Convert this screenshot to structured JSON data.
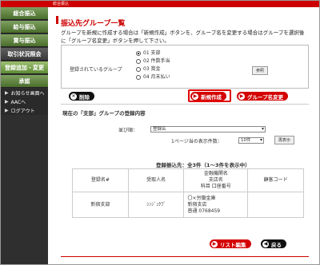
{
  "sidebar": {
    "items": [
      {
        "label": "総合振込",
        "style": "green"
      },
      {
        "label": "給与振込",
        "style": "green"
      },
      {
        "label": "賞与振込",
        "style": "green"
      },
      {
        "label": "取引状況照会",
        "style": "dark"
      },
      {
        "label": "登録追加・変更",
        "style": "active"
      },
      {
        "label": "承認",
        "style": "green"
      }
    ],
    "subs": [
      {
        "label": "お知らせ画面へ"
      },
      {
        "label": "AACへ"
      },
      {
        "label": "ログアウト"
      }
    ]
  },
  "topbar": {
    "label": "総合振込"
  },
  "main": {
    "title": "振込先グループ一覧",
    "intro": "グループを新規に作成する場合は「新規作成」ボタンを、グループ名を変更する場合はグループを選択後に「グループ名変更」ボタンを押して下さい。",
    "group_label": "登録されているグループ",
    "groups": [
      {
        "label": "01 支部",
        "selected": true
      },
      {
        "label": "02 件数手当",
        "selected": false
      },
      {
        "label": "03 賞金",
        "selected": false
      },
      {
        "label": "04 月末払い",
        "selected": false
      }
    ],
    "ref_button": "参照",
    "delete_button": "削除",
    "new_button": "新規作成",
    "rename_button": "グループ名変更",
    "section_title": "現在の「支部」グループの登録内容",
    "sort_label": "並び順：",
    "sort_value": "登録名",
    "per_page_label": "1ページ当の表示件数：",
    "per_page_value": "10件",
    "redisplay_button": "再表示",
    "count_text": "登録振込先：全3件（1～3件を表示中）",
    "table": {
      "headers": [
        "登録名#",
        "受取人名",
        "金融機関名\n支店名\n科目 口座番号",
        "顧客コード"
      ],
      "rows": [
        {
          "name": "新宿支部",
          "recipient": "ｼﾝｼﾞｭｸﾌﾞ",
          "bank": "〇×労働金庫\n新宿支店\n普通 0768459",
          "code": ""
        }
      ]
    },
    "list_edit_button": "リスト編集",
    "back_button": "戻る"
  }
}
